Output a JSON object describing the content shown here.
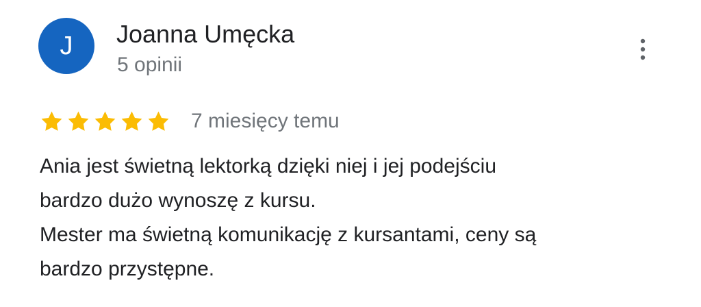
{
  "review": {
    "avatar": {
      "letter": "J",
      "color": "#1565c0"
    },
    "author": {
      "name": "Joanna Umęcka",
      "review_count": "5 opinii"
    },
    "more_options": {
      "icon": "more-vertical-icon"
    },
    "rating": {
      "value": 5,
      "max": 5,
      "star_color": "#fbbc04",
      "icon": "star-icon"
    },
    "time": "7 miesięcy temu",
    "body_lines": [
      "Ania jest świetną lektorką dzięki niej i jej podejściu",
      "bardzo dużo wynoszę z kursu.",
      "Mester ma świetną komunikację z kursantami, ceny są",
      "bardzo przystępne."
    ]
  }
}
